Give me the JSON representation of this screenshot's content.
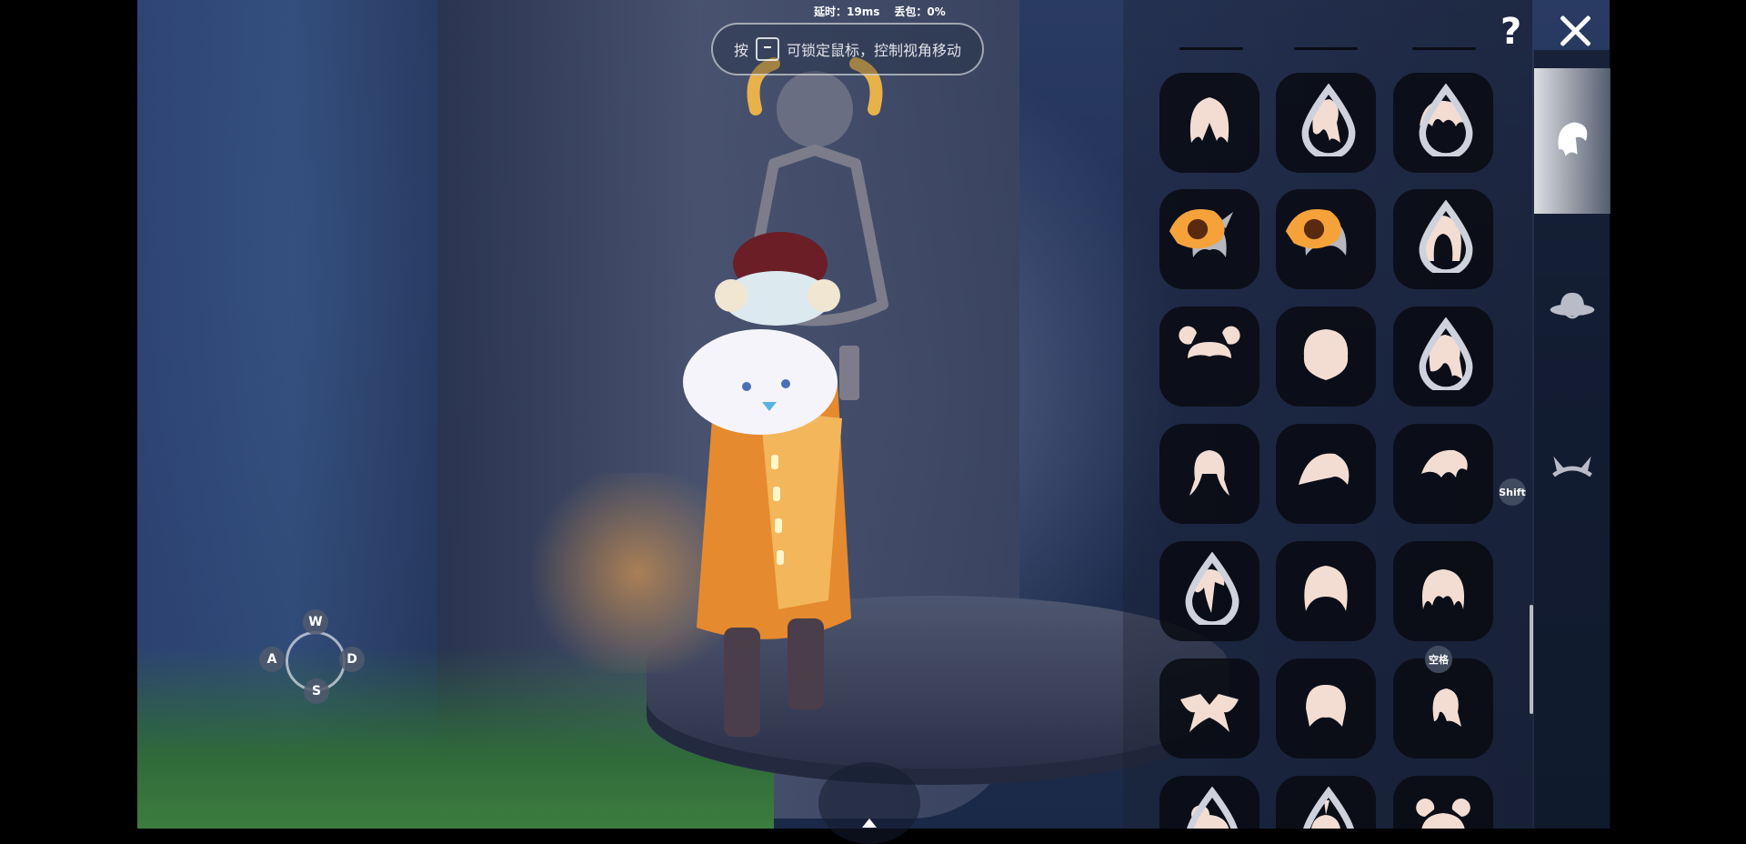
{
  "hud": {
    "latency_label": "延时：19ms",
    "packetloss_label": "丢包：0%",
    "hint_prefix": "按",
    "hint_text": "可锁定鼠标，控制视角移动"
  },
  "controls": {
    "w": "W",
    "a": "A",
    "s": "S",
    "d": "D",
    "shift_label": "Shift",
    "space_label": "空格"
  },
  "panel": {
    "help_label": "?",
    "tabs": [
      {
        "name": "hair",
        "icon": "hair-icon",
        "active": true
      },
      {
        "name": "hat",
        "icon": "hat-icon",
        "active": false
      },
      {
        "name": "horns",
        "icon": "horns-icon",
        "active": false
      }
    ],
    "items": [
      {
        "icon": "hair-long-straight-icon",
        "dlc": false,
        "season": false
      },
      {
        "icon": "hair-ponytail-icon",
        "dlc": true,
        "season": false
      },
      {
        "icon": "hair-curly-short-icon",
        "dlc": true,
        "season": false
      },
      {
        "icon": "hair-horned-icon",
        "dlc": false,
        "season": true
      },
      {
        "icon": "hair-bob-icon",
        "dlc": false,
        "season": true
      },
      {
        "icon": "hair-hood-icon",
        "dlc": true,
        "season": false
      },
      {
        "icon": "hair-double-buns-icon",
        "dlc": false,
        "season": false
      },
      {
        "icon": "hair-lion-icon",
        "dlc": false,
        "season": false
      },
      {
        "icon": "hair-side-tails-icon",
        "dlc": true,
        "season": false
      },
      {
        "icon": "hair-pigtails-icon",
        "dlc": false,
        "season": false
      },
      {
        "icon": "hair-swoop-icon",
        "dlc": false,
        "season": false
      },
      {
        "icon": "hair-spiky-icon",
        "dlc": false,
        "season": false
      },
      {
        "icon": "hair-braid-icon",
        "dlc": true,
        "season": false
      },
      {
        "icon": "hair-bonnet-icon",
        "dlc": false,
        "season": false
      },
      {
        "icon": "hair-wavy-long-icon",
        "dlc": false,
        "season": false
      },
      {
        "icon": "hair-wings-icon",
        "dlc": false,
        "season": false
      },
      {
        "icon": "hair-beanie-icon",
        "dlc": false,
        "season": false
      },
      {
        "icon": "hair-short-tuft-icon",
        "dlc": false,
        "season": false
      },
      {
        "icon": "hair-bun-top-icon",
        "dlc": true,
        "season": false
      },
      {
        "icon": "hair-topknot-icon",
        "dlc": true,
        "season": false
      },
      {
        "icon": "hair-bear-ears-icon",
        "dlc": false,
        "season": false
      }
    ]
  },
  "colors": {
    "hair_icon": "#f3ddd3",
    "hair_icon_locked": "#b7b7bf",
    "season_badge": "#f5a23a"
  }
}
